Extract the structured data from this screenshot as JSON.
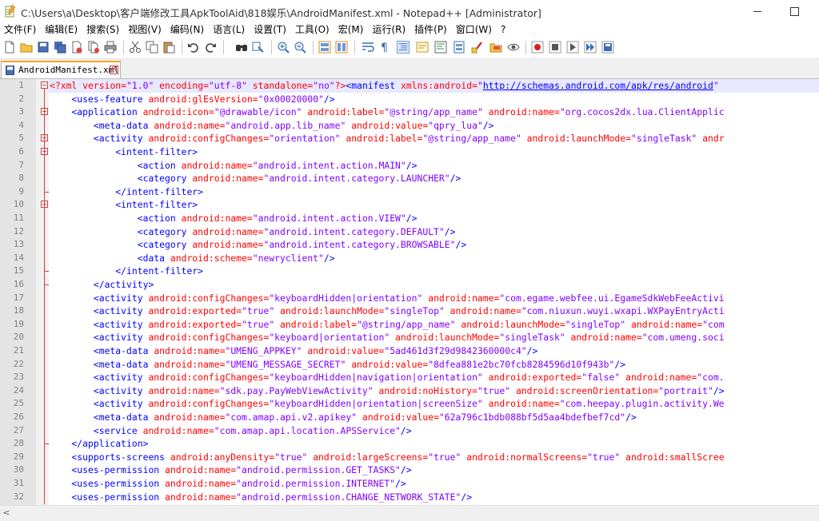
{
  "window": {
    "title": "C:\\Users\\a\\Desktop\\客户端修改工具ApkToolAid\\818娱乐\\AndroidManifest.xml - Notepad++ [Administrator]"
  },
  "menu": [
    "文件(F)",
    "编辑(E)",
    "搜索(S)",
    "视图(V)",
    "编码(N)",
    "语言(L)",
    "设置(T)",
    "工具(O)",
    "宏(M)",
    "运行(R)",
    "插件(P)",
    "窗口(W)",
    "?"
  ],
  "tab": {
    "label": "AndroidManifest.xml"
  },
  "lines": [
    {
      "n": "1",
      "segs": [
        [
          "pi",
          "<?xml "
        ],
        [
          "a",
          "version"
        ],
        [
          "p",
          "="
        ],
        [
          "v",
          "\"1.0\""
        ],
        [
          "a",
          " encoding"
        ],
        [
          "p",
          "="
        ],
        [
          "v",
          "\"utf-8\""
        ],
        [
          "a",
          " standalone"
        ],
        [
          "p",
          "="
        ],
        [
          "v",
          "\"no\""
        ],
        [
          "pi",
          "?>"
        ],
        [
          "t",
          "<manifest "
        ],
        [
          "a",
          "xmlns:android"
        ],
        [
          "p",
          "="
        ],
        [
          "v",
          "\""
        ],
        [
          "u",
          "http://schemas.android.com/apk/res/android"
        ],
        [
          "v",
          "\""
        ]
      ]
    },
    {
      "n": "2",
      "segs": [
        [
          "t",
          "    <uses-feature "
        ],
        [
          "a",
          "android:glEsVersion"
        ],
        [
          "p",
          "="
        ],
        [
          "v",
          "\"0x00020000\""
        ],
        [
          "t",
          "/>"
        ]
      ]
    },
    {
      "n": "3",
      "segs": [
        [
          "t",
          "    <application "
        ],
        [
          "a",
          "android:icon"
        ],
        [
          "p",
          "="
        ],
        [
          "v",
          "\"@drawable/icon\""
        ],
        [
          "a",
          " android:label"
        ],
        [
          "p",
          "="
        ],
        [
          "v",
          "\"@string/app_name\""
        ],
        [
          "a",
          " android:name"
        ],
        [
          "p",
          "="
        ],
        [
          "v",
          "\"org.cocos2dx.lua.ClientApplic"
        ]
      ]
    },
    {
      "n": "4",
      "segs": [
        [
          "t",
          "        <meta-data "
        ],
        [
          "a",
          "android:name"
        ],
        [
          "p",
          "="
        ],
        [
          "v",
          "\"android.app.lib_name\""
        ],
        [
          "a",
          " android:value"
        ],
        [
          "p",
          "="
        ],
        [
          "v",
          "\"qpry_lua\""
        ],
        [
          "t",
          "/>"
        ]
      ]
    },
    {
      "n": "5",
      "segs": [
        [
          "t",
          "        <activity "
        ],
        [
          "a",
          "android:configChanges"
        ],
        [
          "p",
          "="
        ],
        [
          "v",
          "\"orientation\""
        ],
        [
          "a",
          " android:label"
        ],
        [
          "p",
          "="
        ],
        [
          "v",
          "\"@string/app_name\""
        ],
        [
          "a",
          " android:launchMode"
        ],
        [
          "p",
          "="
        ],
        [
          "v",
          "\"singleTask\""
        ],
        [
          "a",
          " andr"
        ]
      ]
    },
    {
      "n": "6",
      "segs": [
        [
          "t",
          "            <intent-filter>"
        ]
      ]
    },
    {
      "n": "7",
      "segs": [
        [
          "t",
          "                <action "
        ],
        [
          "a",
          "android:name"
        ],
        [
          "p",
          "="
        ],
        [
          "v",
          "\"android.intent.action.MAIN\""
        ],
        [
          "t",
          "/>"
        ]
      ]
    },
    {
      "n": "8",
      "segs": [
        [
          "t",
          "                <category "
        ],
        [
          "a",
          "android:name"
        ],
        [
          "p",
          "="
        ],
        [
          "v",
          "\"android.intent.category.LAUNCHER\""
        ],
        [
          "t",
          "/>"
        ]
      ]
    },
    {
      "n": "9",
      "segs": [
        [
          "t",
          "            </intent-filter>"
        ]
      ]
    },
    {
      "n": "10",
      "segs": [
        [
          "t",
          "            <intent-filter>"
        ]
      ]
    },
    {
      "n": "11",
      "segs": [
        [
          "t",
          "                <action "
        ],
        [
          "a",
          "android:name"
        ],
        [
          "p",
          "="
        ],
        [
          "v",
          "\"android.intent.action.VIEW\""
        ],
        [
          "t",
          "/>"
        ]
      ]
    },
    {
      "n": "12",
      "segs": [
        [
          "t",
          "                <category "
        ],
        [
          "a",
          "android:name"
        ],
        [
          "p",
          "="
        ],
        [
          "v",
          "\"android.intent.category.DEFAULT\""
        ],
        [
          "t",
          "/>"
        ]
      ]
    },
    {
      "n": "13",
      "segs": [
        [
          "t",
          "                <category "
        ],
        [
          "a",
          "android:name"
        ],
        [
          "p",
          "="
        ],
        [
          "v",
          "\"android.intent.category.BROWSABLE\""
        ],
        [
          "t",
          "/>"
        ]
      ]
    },
    {
      "n": "14",
      "segs": [
        [
          "t",
          "                <data "
        ],
        [
          "a",
          "android:scheme"
        ],
        [
          "p",
          "="
        ],
        [
          "v",
          "\"newryclient\""
        ],
        [
          "t",
          "/>"
        ]
      ]
    },
    {
      "n": "15",
      "segs": [
        [
          "t",
          "            </intent-filter>"
        ]
      ]
    },
    {
      "n": "16",
      "segs": [
        [
          "t",
          "        </activity>"
        ]
      ]
    },
    {
      "n": "17",
      "segs": [
        [
          "t",
          "        <activity "
        ],
        [
          "a",
          "android:configChanges"
        ],
        [
          "p",
          "="
        ],
        [
          "v",
          "\"keyboardHidden|orientation\""
        ],
        [
          "a",
          " android:name"
        ],
        [
          "p",
          "="
        ],
        [
          "v",
          "\"com.egame.webfee.ui.EgameSdkWebFeeActivi"
        ]
      ]
    },
    {
      "n": "18",
      "segs": [
        [
          "t",
          "        <activity "
        ],
        [
          "a",
          "android:exported"
        ],
        [
          "p",
          "="
        ],
        [
          "v",
          "\"true\""
        ],
        [
          "a",
          " android:launchMode"
        ],
        [
          "p",
          "="
        ],
        [
          "v",
          "\"singleTop\""
        ],
        [
          "a",
          " android:name"
        ],
        [
          "p",
          "="
        ],
        [
          "v",
          "\"com.niuxun.wuyi.wxapi.WXPayEntryActi"
        ]
      ]
    },
    {
      "n": "19",
      "segs": [
        [
          "t",
          "        <activity "
        ],
        [
          "a",
          "android:exported"
        ],
        [
          "p",
          "="
        ],
        [
          "v",
          "\"true\""
        ],
        [
          "a",
          " android:label"
        ],
        [
          "p",
          "="
        ],
        [
          "v",
          "\"@string/app_name\""
        ],
        [
          "a",
          " android:launchMode"
        ],
        [
          "p",
          "="
        ],
        [
          "v",
          "\"singleTop\""
        ],
        [
          "a",
          " android:name"
        ],
        [
          "p",
          "="
        ],
        [
          "v",
          "\"com"
        ]
      ]
    },
    {
      "n": "20",
      "segs": [
        [
          "t",
          "        <activity "
        ],
        [
          "a",
          "android:configChanges"
        ],
        [
          "p",
          "="
        ],
        [
          "v",
          "\"keyboard|orientation\""
        ],
        [
          "a",
          " android:launchMode"
        ],
        [
          "p",
          "="
        ],
        [
          "v",
          "\"singleTask\""
        ],
        [
          "a",
          " android:name"
        ],
        [
          "p",
          "="
        ],
        [
          "v",
          "\"com.umeng.soci"
        ]
      ]
    },
    {
      "n": "21",
      "segs": [
        [
          "t",
          "        <meta-data "
        ],
        [
          "a",
          "android:name"
        ],
        [
          "p",
          "="
        ],
        [
          "v",
          "\"UMENG_APPKEY\""
        ],
        [
          "a",
          " android:value"
        ],
        [
          "p",
          "="
        ],
        [
          "v",
          "\"5ad461d3f29d9842360000c4\""
        ],
        [
          "t",
          "/>"
        ]
      ]
    },
    {
      "n": "22",
      "segs": [
        [
          "t",
          "        <meta-data "
        ],
        [
          "a",
          "android:name"
        ],
        [
          "p",
          "="
        ],
        [
          "v",
          "\"UMENG_MESSAGE_SECRET\""
        ],
        [
          "a",
          " android:value"
        ],
        [
          "p",
          "="
        ],
        [
          "v",
          "\"8dfea881e2bc70fcb8284596d10f943b\""
        ],
        [
          "t",
          "/>"
        ]
      ]
    },
    {
      "n": "23",
      "segs": [
        [
          "t",
          "        <activity "
        ],
        [
          "a",
          "android:configChanges"
        ],
        [
          "p",
          "="
        ],
        [
          "v",
          "\"keyboardHidden|navigation|orientation\""
        ],
        [
          "a",
          " android:exported"
        ],
        [
          "p",
          "="
        ],
        [
          "v",
          "\"false\""
        ],
        [
          "a",
          " android:name"
        ],
        [
          "p",
          "="
        ],
        [
          "v",
          "\"com."
        ]
      ]
    },
    {
      "n": "24",
      "segs": [
        [
          "t",
          "        <activity "
        ],
        [
          "a",
          "android:name"
        ],
        [
          "p",
          "="
        ],
        [
          "v",
          "\"sdk.pay.PayWebViewActivity\""
        ],
        [
          "a",
          " android:noHistory"
        ],
        [
          "p",
          "="
        ],
        [
          "v",
          "\"true\""
        ],
        [
          "a",
          " android:screenOrientation"
        ],
        [
          "p",
          "="
        ],
        [
          "v",
          "\"portrait\""
        ],
        [
          "t",
          "/>"
        ]
      ]
    },
    {
      "n": "25",
      "segs": [
        [
          "t",
          "        <activity "
        ],
        [
          "a",
          "android:configChanges"
        ],
        [
          "p",
          "="
        ],
        [
          "v",
          "\"keyboardHidden|orientation|screenSize\""
        ],
        [
          "a",
          " android:name"
        ],
        [
          "p",
          "="
        ],
        [
          "v",
          "\"com.heepay.plugin.activity.We"
        ]
      ]
    },
    {
      "n": "26",
      "segs": [
        [
          "t",
          "        <meta-data "
        ],
        [
          "a",
          "android:name"
        ],
        [
          "p",
          "="
        ],
        [
          "v",
          "\"com.amap.api.v2.apikey\""
        ],
        [
          "a",
          " android:value"
        ],
        [
          "p",
          "="
        ],
        [
          "v",
          "\"62a796c1bdb088bf5d5aa4bdefbef7cd\""
        ],
        [
          "t",
          "/>"
        ]
      ]
    },
    {
      "n": "27",
      "segs": [
        [
          "t",
          "        <service "
        ],
        [
          "a",
          "android:name"
        ],
        [
          "p",
          "="
        ],
        [
          "v",
          "\"com.amap.api.location.APSService\""
        ],
        [
          "t",
          "/>"
        ]
      ]
    },
    {
      "n": "28",
      "segs": [
        [
          "t",
          "    </application>"
        ]
      ]
    },
    {
      "n": "29",
      "segs": [
        [
          "t",
          "    <supports-screens "
        ],
        [
          "a",
          "android:anyDensity"
        ],
        [
          "p",
          "="
        ],
        [
          "v",
          "\"true\""
        ],
        [
          "a",
          " android:largeScreens"
        ],
        [
          "p",
          "="
        ],
        [
          "v",
          "\"true\""
        ],
        [
          "a",
          " android:normalScreens"
        ],
        [
          "p",
          "="
        ],
        [
          "v",
          "\"true\""
        ],
        [
          "a",
          " android:smallScree"
        ]
      ]
    },
    {
      "n": "30",
      "segs": [
        [
          "t",
          "    <uses-permission "
        ],
        [
          "a",
          "android:name"
        ],
        [
          "p",
          "="
        ],
        [
          "v",
          "\"android.permission.GET_TASKS\""
        ],
        [
          "t",
          "/>"
        ]
      ]
    },
    {
      "n": "31",
      "segs": [
        [
          "t",
          "    <uses-permission "
        ],
        [
          "a",
          "android:name"
        ],
        [
          "p",
          "="
        ],
        [
          "v",
          "\"android.permission.INTERNET\""
        ],
        [
          "t",
          "/>"
        ]
      ]
    },
    {
      "n": "32",
      "segs": [
        [
          "t",
          "    <uses-permission "
        ],
        [
          "a",
          "android:name"
        ],
        [
          "p",
          "="
        ],
        [
          "v",
          "\"android.permission.CHANGE_NETWORK_STATE\""
        ],
        [
          "t",
          "/>"
        ]
      ]
    }
  ],
  "fold_lines": [
    "1",
    "3",
    "5",
    "6",
    "10"
  ],
  "colors": {
    "tag": "#0000ff",
    "attribute": "#ff0000",
    "value": "#8000ff",
    "fold": "#d04040",
    "tab_accent": "#f5a623"
  }
}
